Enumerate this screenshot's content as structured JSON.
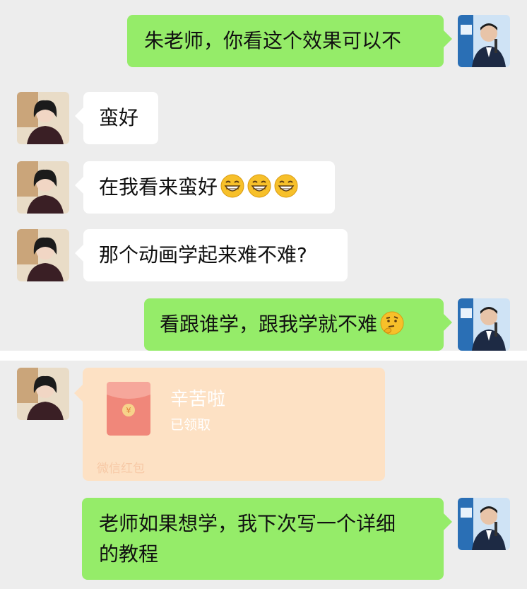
{
  "messages": [
    {
      "sender": "me",
      "text": "朱老师，你看这个效果可以不"
    },
    {
      "sender": "other",
      "text": "蛮好"
    },
    {
      "sender": "other",
      "text": "在我看来蛮好",
      "emojis": [
        "grin-icon",
        "grin-icon",
        "grin-icon"
      ]
    },
    {
      "sender": "other",
      "text": "那个动画学起来难不难?"
    },
    {
      "sender": "me",
      "text": "看跟谁学，跟我学就不难",
      "emojis": [
        "thinking-face-icon"
      ]
    },
    {
      "sender": "other",
      "type": "red_packet",
      "title": "辛苦啦",
      "status": "已领取",
      "footer": "微信红包"
    },
    {
      "sender": "me",
      "lines": [
        "老师如果想学，我下次写一个详细",
        "的教程"
      ]
    }
  ],
  "colors": {
    "background": "#ededed",
    "my_bubble": "#95ec69",
    "other_bubble": "#ffffff",
    "red_packet": "#fde1c4"
  }
}
